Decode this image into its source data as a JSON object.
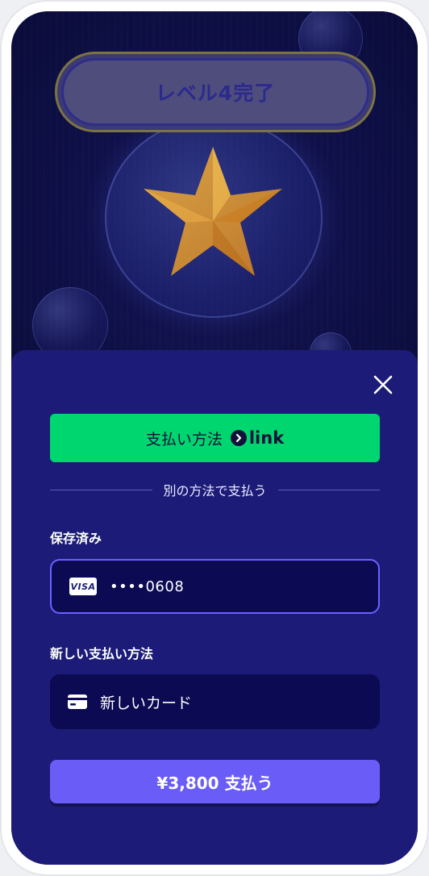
{
  "game": {
    "level_complete_text": "レベル4完了",
    "icons": [
      "star-icon"
    ]
  },
  "payment_sheet": {
    "close_icon": "close-icon",
    "link_button": {
      "label": "支払い方法",
      "brand": "link",
      "color": "#00d66f"
    },
    "divider_text": "別の方法で支払う",
    "saved_section": {
      "title": "保存済み",
      "card": {
        "brand": "VISA",
        "masked_number": "••••0608"
      }
    },
    "new_method_section": {
      "title": "新しい支払い方法",
      "option_label": "新しいカード",
      "icon": "credit-card-icon"
    },
    "pay_button": {
      "label": "¥3,800 支払う",
      "color": "#6a5cf6"
    }
  },
  "colors": {
    "sheet_background": "#1c1c78",
    "game_background": "#0e0f44",
    "selected_border": "#6a62ff"
  }
}
